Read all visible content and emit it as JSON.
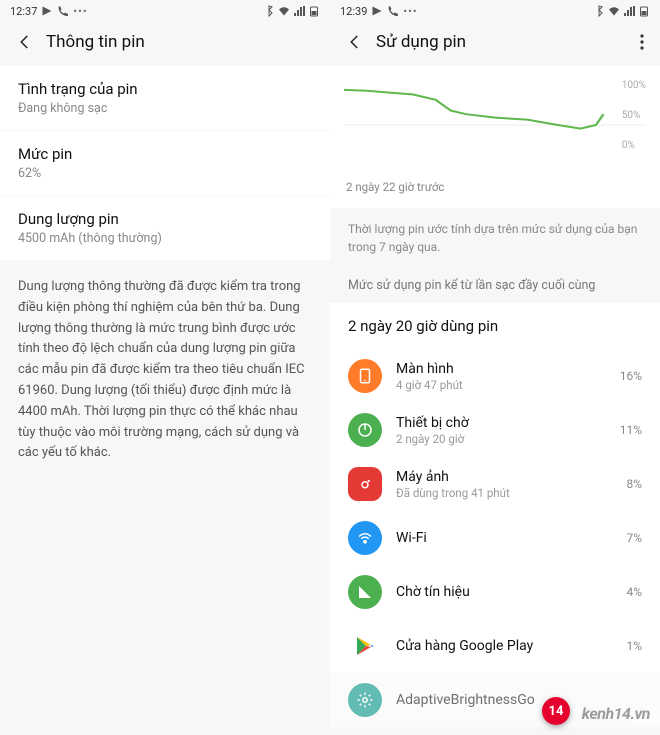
{
  "left": {
    "status": {
      "time": "12:37"
    },
    "header": {
      "title": "Thông tin pin"
    },
    "cards": [
      {
        "title": "Tình trạng của pin",
        "sub": "Đang không sạc"
      },
      {
        "title": "Mức pin",
        "sub": "62%"
      },
      {
        "title": "Dung lượng pin",
        "sub": "4500 mAh (thông thường)"
      }
    ],
    "body": "Dung lượng thông thường đã được kiểm tra trong điều kiện phòng thí nghiệm của bên thứ ba. Dung lượng thông thường là mức trung bình được ước tính theo độ lệch chuẩn của dung lượng pin giữa các mẫu pin đã được kiểm tra theo tiêu chuẩn IEC 61960. Dung lượng (tối thiểu) được định mức là 4400 mAh. Thời lượng pin thực có thể khác nhau tùy thuộc vào môi trường mạng, cách sử dụng và các yếu tố khác."
  },
  "right": {
    "status": {
      "time": "12:39"
    },
    "header": {
      "title": "Sử dụng pin"
    },
    "chart_caption": "2 ngày 22 giờ trước",
    "chart_axis": {
      "t100": "100%",
      "t50": "50%",
      "t0": "0%"
    },
    "desc": "Thời lượng pin ước tính dựa trên mức sử dụng của bạn trong 7 ngày qua.",
    "section": "Mức sử dụng pin kể từ lần sạc đầy cuối cùng",
    "usage_header": "2 ngày 20 giờ dùng pin",
    "items": [
      {
        "name": "Màn hình",
        "sub": "4 giờ 47 phút",
        "pct": "16%"
      },
      {
        "name": "Thiết bị chờ",
        "sub": "2 ngày 20 giờ",
        "pct": "11%"
      },
      {
        "name": "Máy ảnh",
        "sub": "Đã dùng trong 41 phút",
        "pct": "8%"
      },
      {
        "name": "Wi-Fi",
        "sub": "",
        "pct": "7%"
      },
      {
        "name": "Chờ tín hiệu",
        "sub": "",
        "pct": "4%"
      },
      {
        "name": "Cửa hàng Google Play",
        "sub": "",
        "pct": "1%"
      },
      {
        "name": "AdaptiveBrightnessGo",
        "sub": "",
        "pct": ""
      }
    ]
  },
  "chart_data": {
    "type": "line",
    "x_range_hours": 70,
    "ylim": [
      0,
      100
    ],
    "points": [
      {
        "h": 0,
        "v": 89
      },
      {
        "h": 6,
        "v": 88
      },
      {
        "h": 12,
        "v": 86
      },
      {
        "h": 18,
        "v": 84
      },
      {
        "h": 24,
        "v": 78
      },
      {
        "h": 28,
        "v": 66
      },
      {
        "h": 32,
        "v": 62
      },
      {
        "h": 40,
        "v": 58
      },
      {
        "h": 48,
        "v": 56
      },
      {
        "h": 56,
        "v": 50
      },
      {
        "h": 62,
        "v": 46
      },
      {
        "h": 66,
        "v": 50
      },
      {
        "h": 68,
        "v": 62
      }
    ],
    "title": "",
    "xlabel": "",
    "ylabel": ""
  },
  "watermark": {
    "badge": "14",
    "text": "kenh14.vn"
  }
}
